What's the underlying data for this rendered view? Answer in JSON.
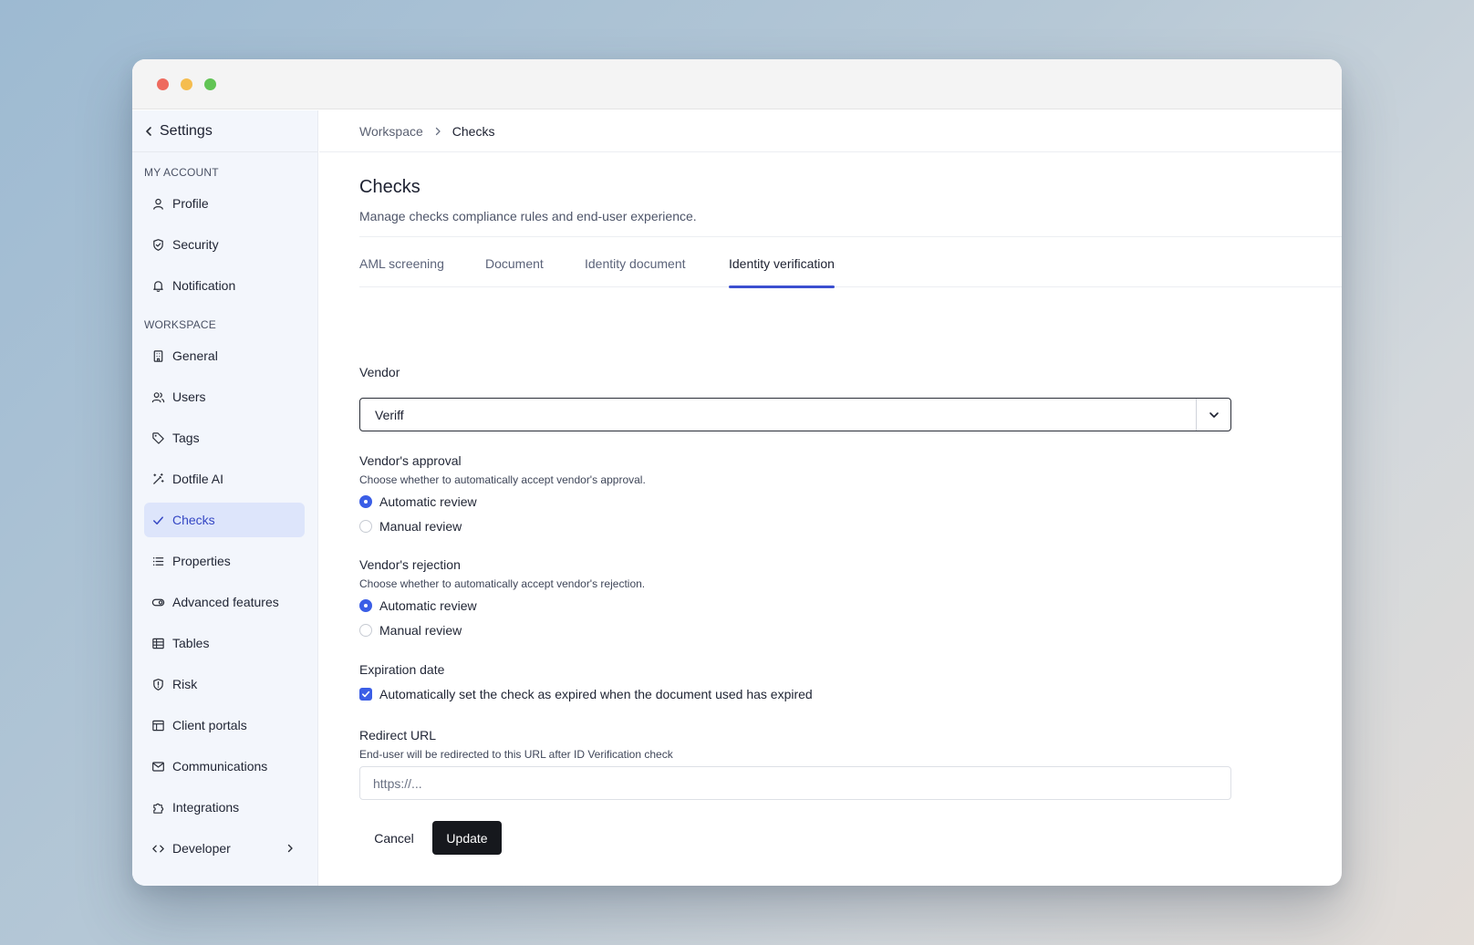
{
  "sidebar": {
    "back_label": "Settings",
    "section_account": "MY ACCOUNT",
    "section_workspace": "WORKSPACE",
    "items": [
      {
        "label": "Profile",
        "icon": "user-icon"
      },
      {
        "label": "Security",
        "icon": "shield-icon"
      },
      {
        "label": "Notification",
        "icon": "bell-icon"
      },
      {
        "label": "General",
        "icon": "building-icon"
      },
      {
        "label": "Users",
        "icon": "users-icon"
      },
      {
        "label": "Tags",
        "icon": "tag-icon"
      },
      {
        "label": "Dotfile AI",
        "icon": "magic-wand-icon"
      },
      {
        "label": "Checks",
        "icon": "check-icon",
        "active": true
      },
      {
        "label": "Properties",
        "icon": "list-icon"
      },
      {
        "label": "Advanced features",
        "icon": "toggle-icon"
      },
      {
        "label": "Tables",
        "icon": "table-icon"
      },
      {
        "label": "Risk",
        "icon": "shield-alert-icon"
      },
      {
        "label": "Client portals",
        "icon": "layout-icon"
      },
      {
        "label": "Communications",
        "icon": "mail-icon"
      },
      {
        "label": "Integrations",
        "icon": "puzzle-icon"
      },
      {
        "label": "Developer",
        "icon": "code-icon"
      }
    ]
  },
  "breadcrumb": {
    "parent": "Workspace",
    "current": "Checks"
  },
  "page": {
    "title": "Checks",
    "description": "Manage checks compliance rules and end-user experience."
  },
  "tabs": [
    {
      "label": "AML screening"
    },
    {
      "label": "Document"
    },
    {
      "label": "Identity document"
    },
    {
      "label": "Identity verification",
      "active": true
    }
  ],
  "form": {
    "vendor_label": "Vendor",
    "vendor_value": "Veriff",
    "approval_label": "Vendor's approval",
    "approval_help": "Choose whether to automatically accept vendor's approval.",
    "approval_options": [
      "Automatic review",
      "Manual review"
    ],
    "approval_selected": "Automatic review",
    "rejection_label": "Vendor's rejection",
    "rejection_help": "Choose whether to automatically accept vendor's rejection.",
    "rejection_options": [
      "Automatic review",
      "Manual review"
    ],
    "rejection_selected": "Automatic review",
    "expiration_label": "Expiration date",
    "expiration_checkbox": "Automatically set the check as expired when the document used has expired",
    "expiration_checked": true,
    "redirect_label": "Redirect URL",
    "redirect_help": "End-user will be redirected to this URL after ID Verification check",
    "redirect_placeholder": "https://...",
    "cancel_label": "Cancel",
    "update_label": "Update"
  },
  "colors": {
    "accent": "#3b5ee6",
    "active_bg": "#dde5fb",
    "primary_button": "#16181d"
  }
}
